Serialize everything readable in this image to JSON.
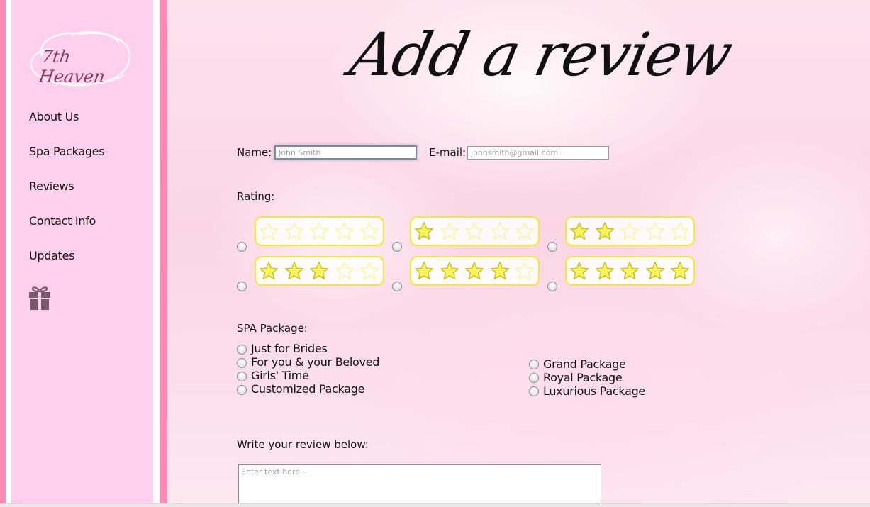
{
  "brand": {
    "logo_text": "7th Heaven"
  },
  "sidebar": {
    "items": [
      {
        "label": "About Us"
      },
      {
        "label": "Spa Packages"
      },
      {
        "label": "Reviews"
      },
      {
        "label": "Contact Info"
      },
      {
        "label": "Updates"
      }
    ],
    "gift_icon": "gift-icon"
  },
  "page": {
    "title": "Add a review"
  },
  "form": {
    "name": {
      "label": "Name:",
      "placeholder": "John Smith",
      "value": ""
    },
    "email": {
      "label": "E-mail:",
      "placeholder": "johnsmith@gmail.com",
      "value": ""
    },
    "rating": {
      "label": "Rating:",
      "options": [
        {
          "stars": 0,
          "max": 5
        },
        {
          "stars": 1,
          "max": 5
        },
        {
          "stars": 2,
          "max": 5
        },
        {
          "stars": 3,
          "max": 5
        },
        {
          "stars": 4,
          "max": 5
        },
        {
          "stars": 5,
          "max": 5
        }
      ]
    },
    "package": {
      "label": "SPA Package:",
      "options_left": [
        "Just for Brides",
        "For you & your Beloved",
        "Girls' Time",
        "Customized Package"
      ],
      "options_right": [
        "Grand Package",
        "Royal Package",
        "Luxurious Package"
      ]
    },
    "review": {
      "label": "Write your review below:",
      "placeholder": "Enter text here..."
    }
  },
  "colors": {
    "sidebar_bg": "#ffd0ee",
    "accent_pink": "#ff8ab4",
    "star_fill": "#f7f35a",
    "star_border": "#f3ea2c"
  }
}
